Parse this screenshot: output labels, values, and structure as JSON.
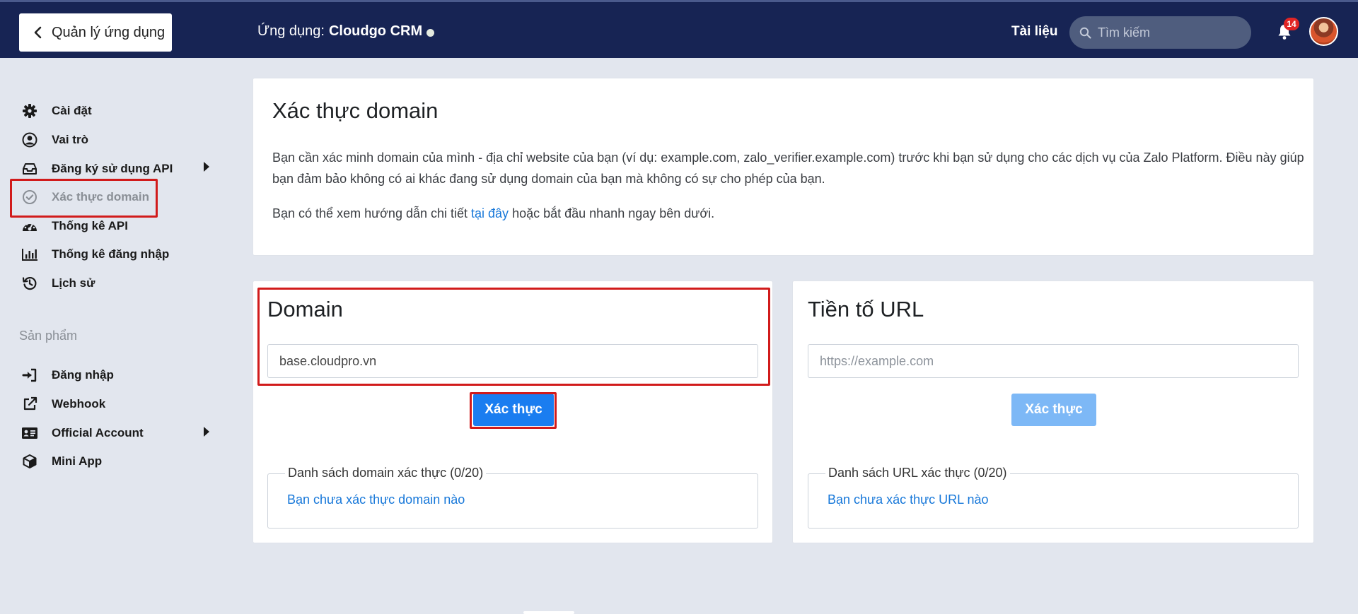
{
  "header": {
    "back_label": "Quản lý ứng dụng",
    "app_prefix": "Ứng dụng:",
    "app_name": "Cloudgo CRM",
    "docs_label": "Tài liệu",
    "search_placeholder": "Tìm kiếm",
    "notification_count": "14"
  },
  "sidebar": {
    "items": [
      {
        "label": "Cài đặt",
        "icon": "gear-icon"
      },
      {
        "label": "Vai trò",
        "icon": "user-circle-icon"
      },
      {
        "label": "Đăng ký sử dụng API",
        "icon": "inbox-icon"
      },
      {
        "label": "Xác thực domain",
        "icon": "check-circle-icon"
      },
      {
        "label": "Thống kê API",
        "icon": "gauge-icon"
      },
      {
        "label": "Thống kê đăng nhập",
        "icon": "bar-chart-icon"
      },
      {
        "label": "Lịch sử",
        "icon": "history-icon"
      }
    ],
    "section_label": "Sản phẩm",
    "products": [
      {
        "label": "Đăng nhập",
        "icon": "sign-in-icon"
      },
      {
        "label": "Webhook",
        "icon": "external-link-icon"
      },
      {
        "label": "Official Account",
        "icon": "id-card-icon"
      },
      {
        "label": "Mini App",
        "icon": "cube-icon"
      }
    ]
  },
  "intro": {
    "title": "Xác thực domain",
    "paragraph_1": "Bạn cần xác minh domain của mình - địa chỉ website của bạn (ví dụ: example.com, zalo_verifier.example.com) trước khi bạn sử dụng cho các dịch vụ của Zalo Platform. Điều này giúp bạn đảm bảo không có ai khác đang sử dụng domain của bạn mà không có sự cho phép của bạn.",
    "paragraph_2_before": "Bạn có thể xem hướng dẫn chi tiết ",
    "paragraph_2_link": "tại đây",
    "paragraph_2_after": " hoặc bắt đầu nhanh ngay bên dưới."
  },
  "domain_card": {
    "title": "Domain",
    "input_value": "base.cloudpro.vn",
    "button_label": "Xác thực",
    "list_legend": "Danh sách domain xác thực (0/20)",
    "empty_text": "Bạn chưa xác thực domain nào"
  },
  "url_card": {
    "title": "Tiền tố URL",
    "input_placeholder": "https://example.com",
    "button_label": "Xác thực",
    "list_legend": "Danh sách URL xác thực (0/20)",
    "empty_text": "Bạn chưa xác thực URL nào"
  },
  "colors": {
    "header_bg": "#172454",
    "primary": "#1a7df0",
    "link": "#1677d9",
    "highlight": "#d11b1b"
  }
}
